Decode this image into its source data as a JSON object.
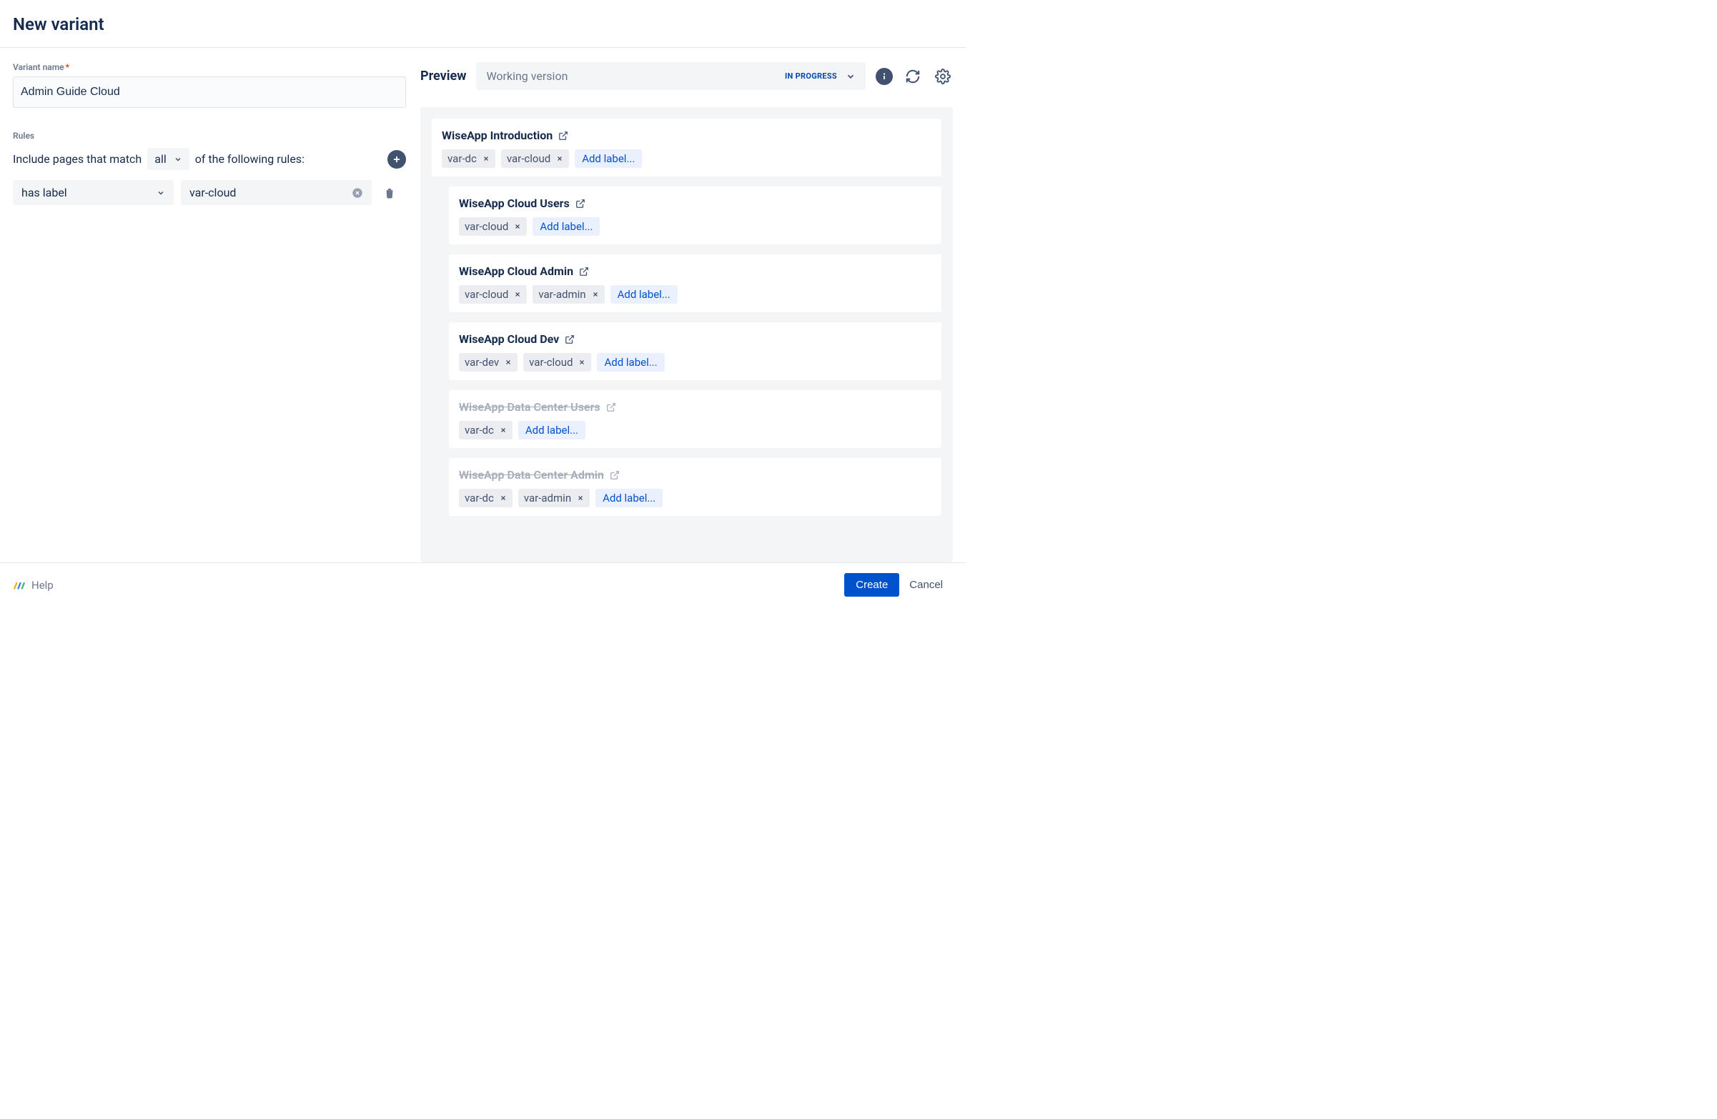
{
  "header": {
    "title": "New variant"
  },
  "fields": {
    "variant_name_label": "Variant name",
    "variant_name_value": "Admin Guide Cloud"
  },
  "rules": {
    "label": "Rules",
    "include_prefix": "Include pages that match",
    "quantifier": "all",
    "include_suffix": "of the following rules:",
    "items": [
      {
        "condition": "has label",
        "value": "var-cloud"
      }
    ]
  },
  "preview": {
    "title": "Preview",
    "version": "Working version",
    "status": "IN PROGRESS",
    "pages": [
      {
        "title": "WiseApp Introduction",
        "excluded": false,
        "indent": 0,
        "labels": [
          "var-dc",
          "var-cloud"
        ]
      },
      {
        "title": "WiseApp Cloud Users",
        "excluded": false,
        "indent": 1,
        "labels": [
          "var-cloud"
        ]
      },
      {
        "title": "WiseApp Cloud Admin",
        "excluded": false,
        "indent": 1,
        "labels": [
          "var-cloud",
          "var-admin"
        ]
      },
      {
        "title": "WiseApp Cloud Dev",
        "excluded": false,
        "indent": 1,
        "labels": [
          "var-dev",
          "var-cloud"
        ]
      },
      {
        "title": "WiseApp Data Center Users",
        "excluded": true,
        "indent": 1,
        "labels": [
          "var-dc"
        ]
      },
      {
        "title": "WiseApp Data Center Admin",
        "excluded": true,
        "indent": 1,
        "labels": [
          "var-dc",
          "var-admin"
        ]
      }
    ],
    "add_label_text": "Add label..."
  },
  "footer": {
    "help": "Help",
    "create": "Create",
    "cancel": "Cancel"
  }
}
